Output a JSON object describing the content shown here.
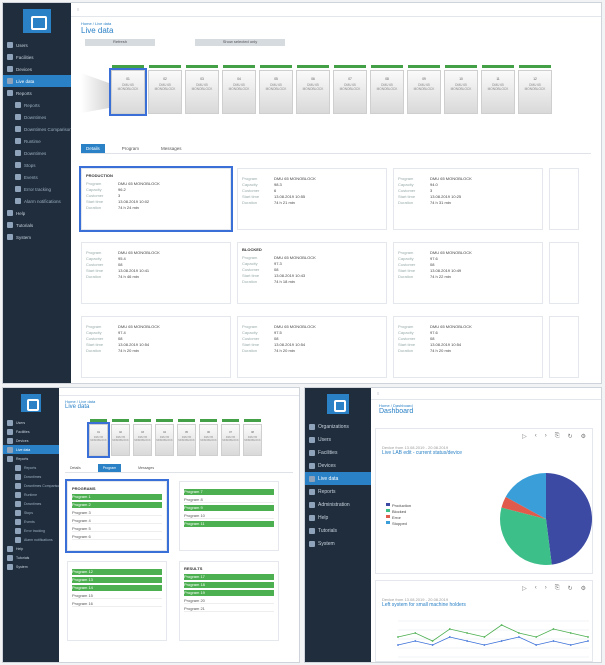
{
  "app": {
    "accent": "#2a81c6",
    "sidebar_bg": "#1f2d3d",
    "status_green": "#43a047",
    "highlight": "#3a6fd8"
  },
  "top": {
    "breadcrumb": "Home / Live data",
    "title": "Live data",
    "buttons": [
      "Refresh",
      "Show selected only"
    ],
    "machines": [
      "01",
      "02",
      "03",
      "04",
      "05",
      "06",
      "07",
      "08",
      "09",
      "10",
      "11",
      "12"
    ],
    "machine_label": "DMU 65 MONOBLOCK",
    "tabs": [
      "Details",
      "Program",
      "Messages"
    ],
    "card_keys": [
      "Program",
      "Capacity",
      "Customer",
      "Start time",
      "Duration"
    ],
    "cards": [
      {
        "title": "PRODUCTION",
        "values": [
          "DMU 65 MONOBLOCK",
          "96.2",
          "3",
          "13.08.2019 10:02",
          "74 h 24 min"
        ]
      },
      {
        "title": "",
        "values": [
          "DMU 65 MONOBLOCK",
          "98.3",
          "6",
          "13.08.2019 10:55",
          "74 h 21 min"
        ]
      },
      {
        "title": "",
        "values": [
          "DMU 65 MONOBLOCK",
          "94.0",
          "3",
          "13.08.2019 10:25",
          "74 h 31 min"
        ]
      },
      {
        "title": "",
        "values": [
          "DMU 65 MONOBLOCK",
          "95.4",
          "08",
          "13.08.2019 10:41",
          "74 h 46 min"
        ]
      },
      {
        "title": "BLOCKED",
        "values": [
          "DMU 65 MONOBLOCK",
          "97.3",
          "08",
          "13.08.2019 10:43",
          "74 h 18 min"
        ]
      },
      {
        "title": "",
        "values": [
          "DMU 65 MONOBLOCK",
          "97.6",
          "08",
          "13.08.2019 10:49",
          "74 h 22 min"
        ]
      },
      {
        "title": "",
        "values": [
          "DMU 65 MONOBLOCK",
          "97.4",
          "08",
          "13.08.2019 10:54",
          "74 h 20 min"
        ]
      },
      {
        "title": "",
        "values": [
          "DMU 65 MONOBLOCK",
          "97.5",
          "08",
          "13.08.2019 10:54",
          "74 h 20 min"
        ]
      },
      {
        "title": "",
        "values": [
          "DMU 65 MONOBLOCK",
          "97.6",
          "08",
          "13.08.2019 10:54",
          "74 h 20 min"
        ]
      }
    ]
  },
  "nav": {
    "items": [
      {
        "label": "Users",
        "type": "main"
      },
      {
        "label": "Facilities",
        "type": "main"
      },
      {
        "label": "Devices",
        "type": "main"
      },
      {
        "label": "Live data",
        "type": "active"
      },
      {
        "label": "Reports",
        "type": "main"
      },
      {
        "label": "Reports",
        "type": "sub"
      },
      {
        "label": "Downtimes",
        "type": "sub"
      },
      {
        "label": "Downtimes Comparison",
        "type": "sub"
      },
      {
        "label": "Runtime",
        "type": "sub"
      },
      {
        "label": "Downtimes",
        "type": "sub"
      },
      {
        "label": "Stops",
        "type": "sub"
      },
      {
        "label": "Events",
        "type": "sub"
      },
      {
        "label": "Error tracking",
        "type": "sub"
      },
      {
        "label": "Alarm notifications",
        "type": "sub"
      },
      {
        "label": "Help",
        "type": "main"
      },
      {
        "label": "Tutorials",
        "type": "main"
      },
      {
        "label": "System",
        "type": "main"
      }
    ]
  },
  "bl": {
    "breadcrumb": "Home / Live data",
    "title": "Live data",
    "tabs": [
      "Details",
      "Program",
      "Messages"
    ],
    "list1_title": "PROGRAMS",
    "list1": [
      "Program 1",
      "Program 2",
      "Program 3",
      "Program 4",
      "Program 5",
      "Program 6"
    ],
    "list2_title": "",
    "list2": [
      "Program 7",
      "Program 8",
      "Program 9",
      "Program 10",
      "Program 11"
    ],
    "list3_title": "",
    "list3": [
      "Program 12",
      "Program 13",
      "Program 14",
      "Program 15",
      "Program 16"
    ],
    "list4_title": "RESULTS",
    "list4": [
      "Program 17",
      "Program 18",
      "Program 19",
      "Program 20",
      "Program 21"
    ]
  },
  "br": {
    "breadcrumb": "Home / Dashboard",
    "title": "Dashboard",
    "nav": [
      "Organizations",
      "Users",
      "Facilities",
      "Devices",
      "Live data",
      "Reports",
      "Administration",
      "Help",
      "Tutorials",
      "System"
    ],
    "chart1_meta": "Device from 13.08.2019 - 20.08.2019",
    "chart1_title": "Live LAB edit - current status/device",
    "legend": [
      "Production",
      "Blocked",
      "Error",
      "Stopped"
    ],
    "chart2_meta": "Device from 13.08.2019 - 20.08.2019",
    "chart2_title": "Left system for small machine holders"
  },
  "chart_data": [
    {
      "type": "pie",
      "title": "Live LAB edit - current status/device",
      "labels": [
        "Production",
        "Blocked",
        "Error",
        "Stopped"
      ],
      "values": [
        48,
        31,
        4,
        17
      ],
      "colors": [
        "#3c4aa3",
        "#3dbf8a",
        "#e05b4b",
        "#3a9fd8"
      ]
    },
    {
      "type": "line",
      "title": "Left system for small machine holders",
      "x": [
        1,
        2,
        3,
        4,
        5,
        6,
        7,
        8,
        9,
        10,
        11,
        12
      ],
      "series": [
        {
          "values": [
            5,
            6,
            4,
            7,
            6,
            5,
            8,
            6,
            5,
            7,
            6,
            5
          ],
          "color": "#4caf50"
        },
        {
          "values": [
            3,
            4,
            3,
            5,
            4,
            3,
            4,
            5,
            3,
            4,
            3,
            4
          ],
          "color": "#3a6fd8"
        }
      ]
    }
  ]
}
